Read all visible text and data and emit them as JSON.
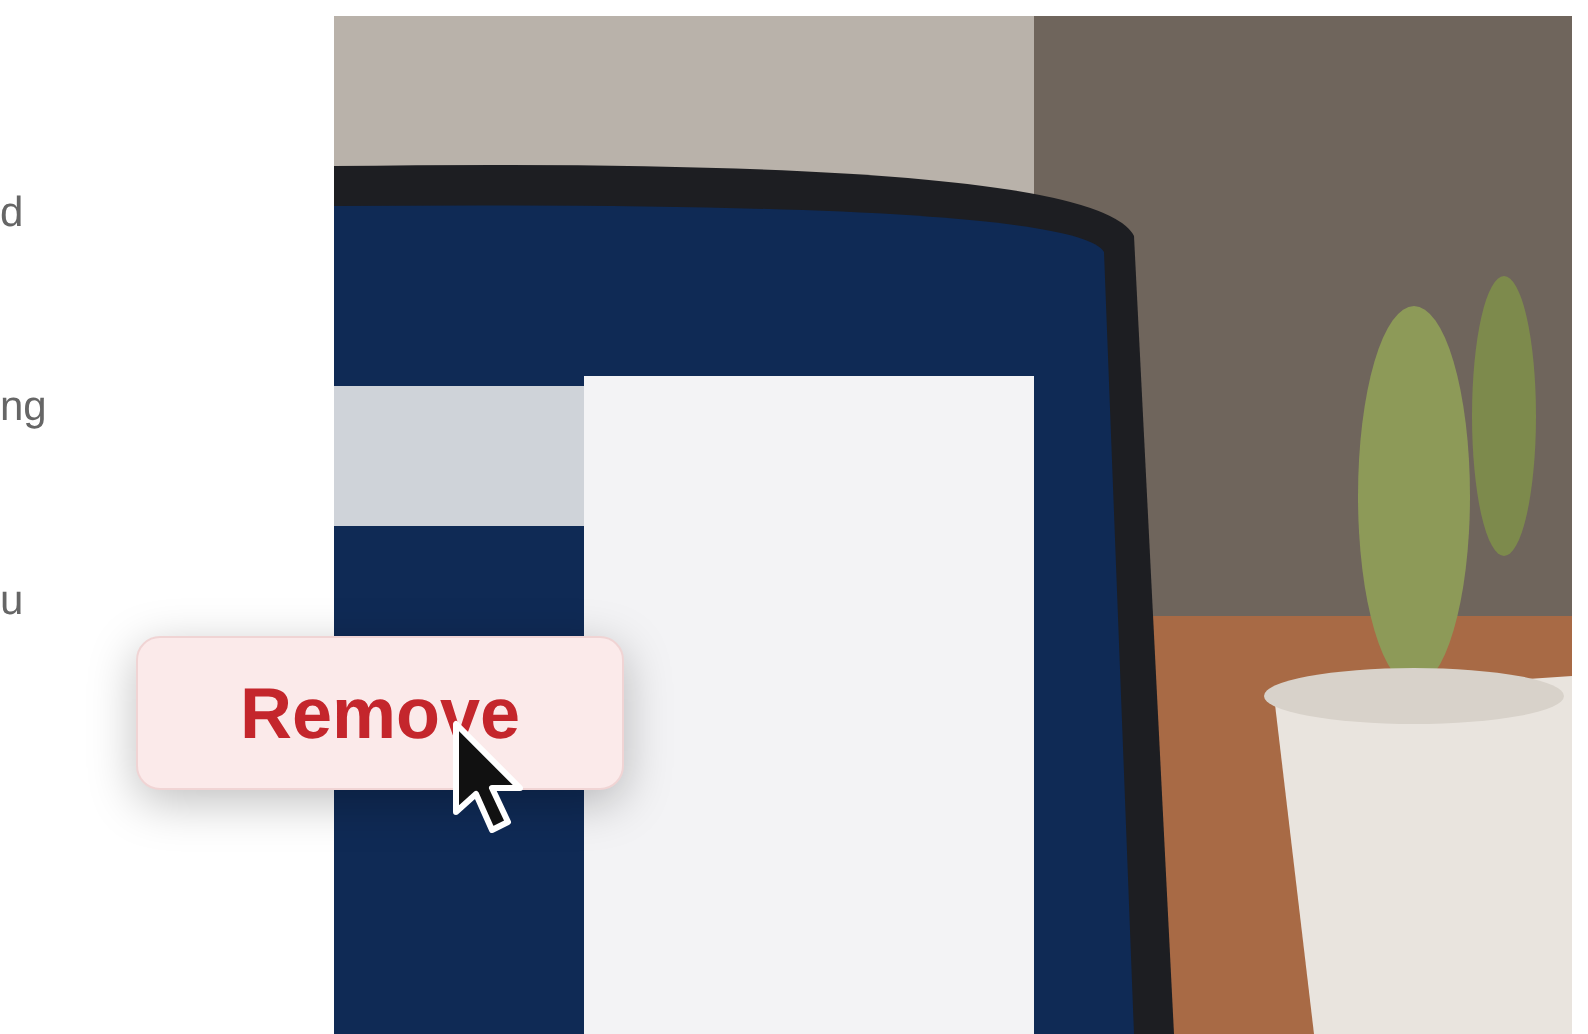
{
  "intro_text": [
    "d",
    "ng",
    "u"
  ],
  "hero": {
    "kind": "picture",
    "callout": {
      "label": "Remove"
    }
  }
}
